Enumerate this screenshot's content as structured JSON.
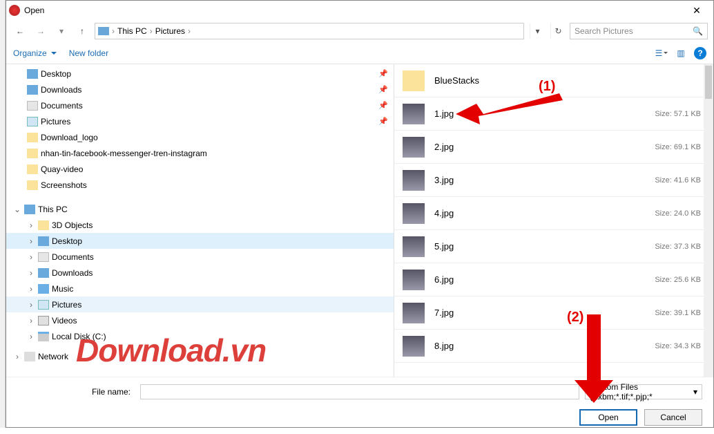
{
  "window": {
    "title": "Open"
  },
  "nav": {
    "crumbs": [
      "This PC",
      "Pictures"
    ],
    "search_placeholder": "Search Pictures"
  },
  "toolbar": {
    "organize": "Organize",
    "newfolder": "New folder"
  },
  "quick_access": [
    {
      "name": "Desktop",
      "icon": "mon",
      "pinned": true
    },
    {
      "name": "Downloads",
      "icon": "dl",
      "pinned": true
    },
    {
      "name": "Documents",
      "icon": "doc",
      "pinned": true
    },
    {
      "name": "Pictures",
      "icon": "pic",
      "pinned": true
    },
    {
      "name": "Download_logo",
      "icon": "folder"
    },
    {
      "name": "nhan-tin-facebook-messenger-tren-instagram",
      "icon": "folder"
    },
    {
      "name": "Quay-video",
      "icon": "folder"
    },
    {
      "name": "Screenshots",
      "icon": "folder"
    }
  ],
  "thispc": {
    "label": "This PC",
    "children": [
      {
        "name": "3D Objects",
        "icon": "folder"
      },
      {
        "name": "Desktop",
        "icon": "mon",
        "sel": true
      },
      {
        "name": "Documents",
        "icon": "doc"
      },
      {
        "name": "Downloads",
        "icon": "dl"
      },
      {
        "name": "Music",
        "icon": "music"
      },
      {
        "name": "Pictures",
        "icon": "pic",
        "sel2": true
      },
      {
        "name": "Videos",
        "icon": "vid"
      },
      {
        "name": "Local Disk (C:)",
        "icon": "disk"
      }
    ]
  },
  "network": {
    "label": "Network"
  },
  "files": [
    {
      "name": "BlueStacks",
      "type": "folder"
    },
    {
      "name": "1.jpg",
      "type": "img",
      "size": "Size: 57.1 KB"
    },
    {
      "name": "2.jpg",
      "type": "img",
      "size": "Size: 69.1 KB"
    },
    {
      "name": "3.jpg",
      "type": "img",
      "size": "Size: 41.6 KB"
    },
    {
      "name": "4.jpg",
      "type": "img",
      "size": "Size: 24.0 KB"
    },
    {
      "name": "5.jpg",
      "type": "img",
      "size": "Size: 37.3 KB"
    },
    {
      "name": "6.jpg",
      "type": "img",
      "size": "Size: 25.6 KB"
    },
    {
      "name": "7.jpg",
      "type": "img",
      "size": "Size: 39.1 KB"
    },
    {
      "name": "8.jpg",
      "type": "img",
      "size": "Size: 34.3 KB"
    }
  ],
  "bottom": {
    "filename_label": "File name:",
    "filetype": "Custom Files (*.xbm;*.tif;*.pjp;*",
    "open": "Open",
    "cancel": "Cancel"
  },
  "annotations": {
    "a1": "(1)",
    "a2": "(2)"
  },
  "watermark": "Download.vn"
}
